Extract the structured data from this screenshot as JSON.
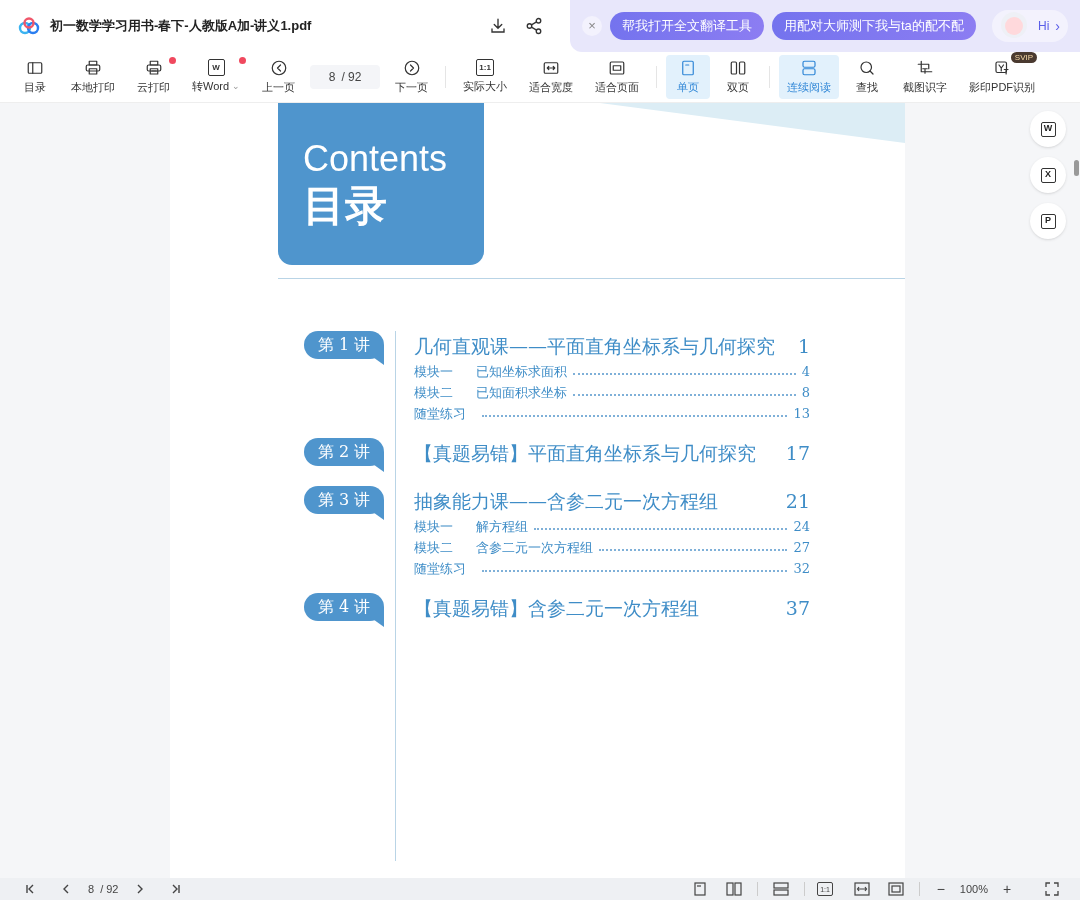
{
  "header": {
    "title": "初一数学学习用书-春下-人教版A加-讲义1.pdf",
    "close": "×",
    "prompts": [
      "帮我打开全文翻译工具",
      "用配对大师测下我与ta的配不配"
    ],
    "assistant": {
      "label": "Hi",
      "chevron": "›"
    }
  },
  "toolbar": [
    {
      "kind": "button",
      "label": "目录",
      "selected": false,
      "dot": false
    },
    {
      "kind": "button",
      "label": "本地打印",
      "selected": false,
      "dot": false
    },
    {
      "kind": "button",
      "label": "云打印",
      "selected": false,
      "dot": true
    },
    {
      "kind": "button",
      "label": "转Word",
      "icon_text": "W",
      "caret": "⌄",
      "selected": false,
      "dot": true
    },
    {
      "kind": "button",
      "label": "上一页",
      "selected": false,
      "dot": false
    },
    {
      "kind": "page",
      "value": "8",
      "total": "/ 92"
    },
    {
      "kind": "button",
      "label": "下一页",
      "selected": false,
      "dot": false
    },
    {
      "kind": "divider"
    },
    {
      "kind": "button",
      "label": "实际大小",
      "icon_text": "1:1",
      "selected": false,
      "dot": false
    },
    {
      "kind": "button",
      "label": "适合宽度",
      "selected": false,
      "dot": false
    },
    {
      "kind": "button",
      "label": "适合页面",
      "selected": false,
      "dot": false
    },
    {
      "kind": "divider"
    },
    {
      "kind": "button",
      "label": "单页",
      "selected": true,
      "dot": false
    },
    {
      "kind": "button",
      "label": "双页",
      "selected": false,
      "dot": false
    },
    {
      "kind": "divider"
    },
    {
      "kind": "button",
      "label": "连续阅读",
      "selected": true,
      "dot": false
    },
    {
      "kind": "button",
      "label": "查找",
      "selected": false,
      "dot": false
    },
    {
      "kind": "button",
      "label": "截图识字",
      "selected": false,
      "dot": false
    },
    {
      "kind": "button",
      "label": "影印PDF识别",
      "badge": "SVIP",
      "selected": false,
      "dot": false
    }
  ],
  "page": {
    "heading": "Contents",
    "heading_cn": "目录",
    "lectures": [
      {
        "badge": "第 1 讲",
        "title": "几何直观课——平面直角坐标系与几何探究",
        "page": "1",
        "sections": [
          {
            "label": "模块一",
            "title": "已知坐标求面积",
            "page": "4"
          },
          {
            "label": "模块二",
            "title": "已知面积求坐标",
            "page": "8"
          },
          {
            "label": "随堂练习",
            "page": "13"
          }
        ]
      },
      {
        "badge": "第 2 讲",
        "title": "【真题易错】平面直角坐标系与几何探究",
        "page": "17"
      },
      {
        "badge": "第 3 讲",
        "title": "抽象能力课——含参二元一次方程组",
        "page": "21",
        "sections": [
          {
            "label": "模块一",
            "title": "解方程组",
            "page": "24"
          },
          {
            "label": "模块二",
            "title": "含参二元一次方程组",
            "page": "27"
          },
          {
            "label": "随堂练习",
            "page": "32"
          }
        ]
      },
      {
        "badge": "第 4 讲",
        "title": "【真题易错】含参二元一次方程组",
        "page": "37"
      }
    ]
  },
  "side_tools": [
    "W",
    "X",
    "P"
  ],
  "status_bar": {
    "page": "8",
    "total": "/ 92",
    "zoom": "100%",
    "zoom_out": "−",
    "zoom_in": "+",
    "ratio_icon": "1:1"
  }
}
